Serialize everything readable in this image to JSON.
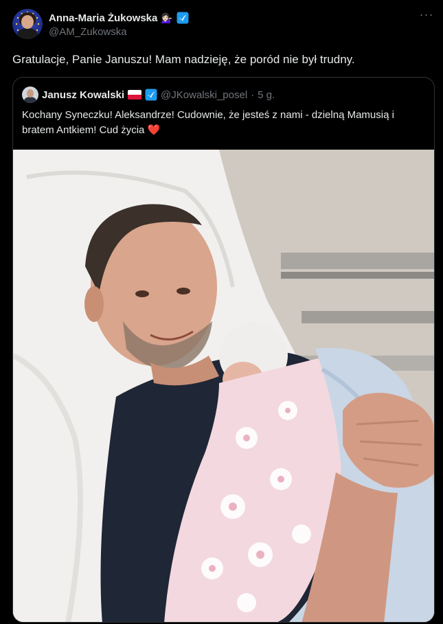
{
  "author": {
    "display_name": "Anna-Maria Żukowska",
    "badge_emoji": "💁🏻‍♀️",
    "handle": "@AM_Zukowska"
  },
  "more_glyph": "···",
  "tweet": {
    "text": "Gratulacje, Panie Januszu! Mam nadzieję, że poród nie był trudny."
  },
  "quoted": {
    "display_name": "Janusz Kowalski",
    "handle": "@JKowalski_posel",
    "separator": "·",
    "time": "5 g.",
    "text": "Kochany Syneczku! Aleksandrze! Cudownie, że jesteś z nami - dzielną Mamusią i bratem Antkiem! Cud życia",
    "heart": "❤️"
  },
  "colors": {
    "background": "#000000",
    "text_primary": "#e7e9ea",
    "text_secondary": "#71767b",
    "border": "#2f3336",
    "verified_blue": "#1d9bf0",
    "heart_red": "#e0245e"
  },
  "icons": {
    "verified": "verified-badge-icon",
    "more": "more-options-icon",
    "flag": "poland-flag-icon",
    "heart": "red-heart-icon"
  }
}
